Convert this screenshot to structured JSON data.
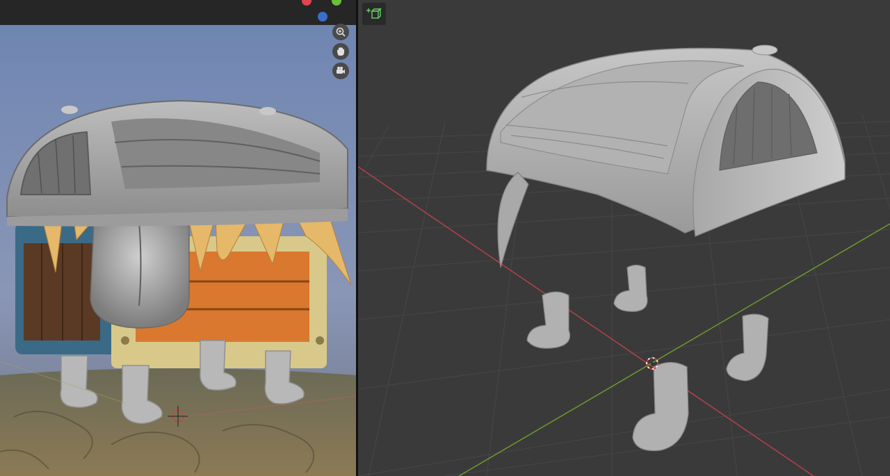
{
  "left_viewport": {
    "view": "reference-render",
    "gizmo": {
      "buttons": [
        {
          "name": "zoom-icon"
        },
        {
          "name": "hand-pan-icon"
        },
        {
          "name": "camera-icon"
        }
      ],
      "header_dots": [
        {
          "name": "red-dot",
          "color": "#e0454f"
        },
        {
          "name": "green-dot",
          "color": "#6abf3a"
        },
        {
          "name": "blue-dot",
          "color": "#3b6fc7"
        }
      ]
    }
  },
  "right_viewport": {
    "view": "sculpt-solid",
    "toolbar": {
      "add_object_icon": "add-cube-icon"
    },
    "axis_colors": {
      "x": "#b5414a",
      "y": "#6d9a2c"
    },
    "background_color": "#3a3a3a"
  },
  "colors": {
    "clay": "#b5b5b5",
    "wood_orange": "#d9782e",
    "teeth": "#e6b86a",
    "chest_blue": "#3b6a86"
  }
}
